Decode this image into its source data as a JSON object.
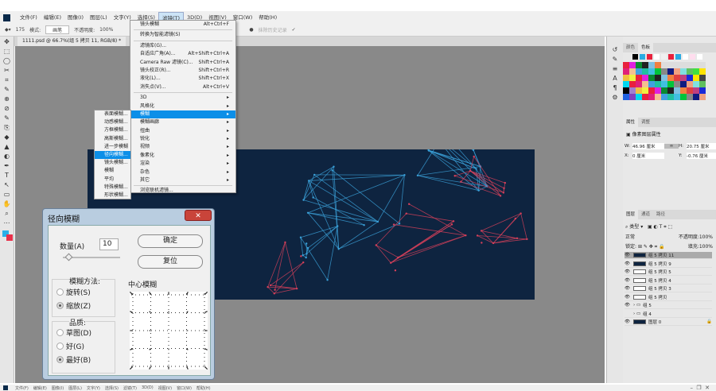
{
  "menu": [
    "文件(F)",
    "编辑(E)",
    "图像(I)",
    "图层(L)",
    "文字(Y)",
    "选择(S)",
    "滤镜(T)",
    "3D(D)",
    "视图(V)",
    "窗口(W)",
    "帮助(H)"
  ],
  "active_menu": "滤镜(T)",
  "options": {
    "brush_size": "175",
    "mode_label": "模式:",
    "mode_value": "画笔",
    "opacity_label": "不透明度:",
    "opacity_value": "100%",
    "history_label": "抹除历史记录"
  },
  "doc_tab": "1111.psd @ 66.7%(组 5 拷贝 11, RGB/8) *",
  "filter_menu": [
    {
      "label": "镜头模糊",
      "shortcut": "Alt+Ctrl+F"
    },
    {
      "sep": true
    },
    {
      "label": "转换为智能滤镜(S)",
      "shortcut": ""
    },
    {
      "sep": true
    },
    {
      "label": "滤镜库(G)...",
      "shortcut": ""
    },
    {
      "label": "自适应广角(A)...",
      "shortcut": "Alt+Shift+Ctrl+A"
    },
    {
      "label": "Camera Raw 滤镜(C)...",
      "shortcut": "Shift+Ctrl+A"
    },
    {
      "label": "镜头校正(R)...",
      "shortcut": "Shift+Ctrl+R"
    },
    {
      "label": "液化(L)...",
      "shortcut": "Shift+Ctrl+X"
    },
    {
      "label": "消失点(V)...",
      "shortcut": "Alt+Ctrl+V"
    },
    {
      "sep": true
    },
    {
      "label": "3D",
      "shortcut": "▸"
    },
    {
      "label": "风格化",
      "shortcut": "▸"
    },
    {
      "label": "模糊",
      "shortcut": "▸",
      "hl": true
    },
    {
      "label": "模糊画廊",
      "shortcut": "▸"
    },
    {
      "label": "扭曲",
      "shortcut": "▸"
    },
    {
      "label": "锐化",
      "shortcut": "▸"
    },
    {
      "label": "视频",
      "shortcut": "▸"
    },
    {
      "label": "像素化",
      "shortcut": "▸"
    },
    {
      "label": "渲染",
      "shortcut": "▸"
    },
    {
      "label": "杂色",
      "shortcut": "▸"
    },
    {
      "label": "其它",
      "shortcut": "▸"
    },
    {
      "sep": true
    },
    {
      "label": "浏览联机滤镜...",
      "shortcut": ""
    }
  ],
  "blur_submenu": [
    "表面模糊...",
    "动感模糊...",
    "方框模糊...",
    "高斯模糊...",
    "进一步模糊",
    "径向模糊...",
    "镜头模糊...",
    "模糊",
    "平均",
    "特殊模糊...",
    "形状模糊..."
  ],
  "blur_submenu_selected": 5,
  "dialog": {
    "title": "径向模糊",
    "close": "✕",
    "amount_label": "数量(A)",
    "amount_value": "10",
    "amount_fraction": 0.1,
    "ok": "确定",
    "reset": "复位",
    "method_label": "模糊方法:",
    "method_options": [
      "旋转(S)",
      "缩放(Z)"
    ],
    "method_selected": 1,
    "quality_label": "品质:",
    "quality_options": [
      "草图(D)",
      "好(G)",
      "最好(B)"
    ],
    "quality_selected": 2,
    "center_label": "中心模糊"
  },
  "swatch_panel": {
    "tabs": [
      "颜色",
      "色板"
    ],
    "active": 1
  },
  "properties_panel": {
    "tabs": [
      "属性",
      "调整"
    ],
    "title": "像素图层属性",
    "w_label": "W:",
    "w": "46.96 厘米",
    "h_label": "H:",
    "h": "20.75 厘米",
    "x_label": "X:",
    "x": "0 厘米",
    "y_label": "Y:",
    "y": "-0.76 厘米"
  },
  "layers_panel": {
    "tabs": [
      "图层",
      "通道",
      "路径"
    ],
    "filter": "类型",
    "blend": "正常",
    "opacity_label": "不透明度:",
    "opacity": "100%",
    "lock_label": "锁定:",
    "fill_label": "填充:",
    "fill": "100%",
    "layers": [
      {
        "name": "组 5 拷贝 11",
        "sel": true
      },
      {
        "name": "组 5 拷贝 9"
      },
      {
        "name": "组 5 拷贝 5"
      },
      {
        "name": "组 5 拷贝 4"
      },
      {
        "name": "组 5 拷贝 3"
      },
      {
        "name": "组 5 拷贝"
      },
      {
        "name": "组 5",
        "group": true
      },
      {
        "name": "组 4",
        "group": true,
        "hidden": true
      },
      {
        "name": "图层 0",
        "locked": true
      }
    ]
  },
  "colors": {
    "image_bg": "#0e2440",
    "accent": "#0d8fe8",
    "line_blue": "#3aa0d8",
    "line_red": "#d8405a"
  }
}
